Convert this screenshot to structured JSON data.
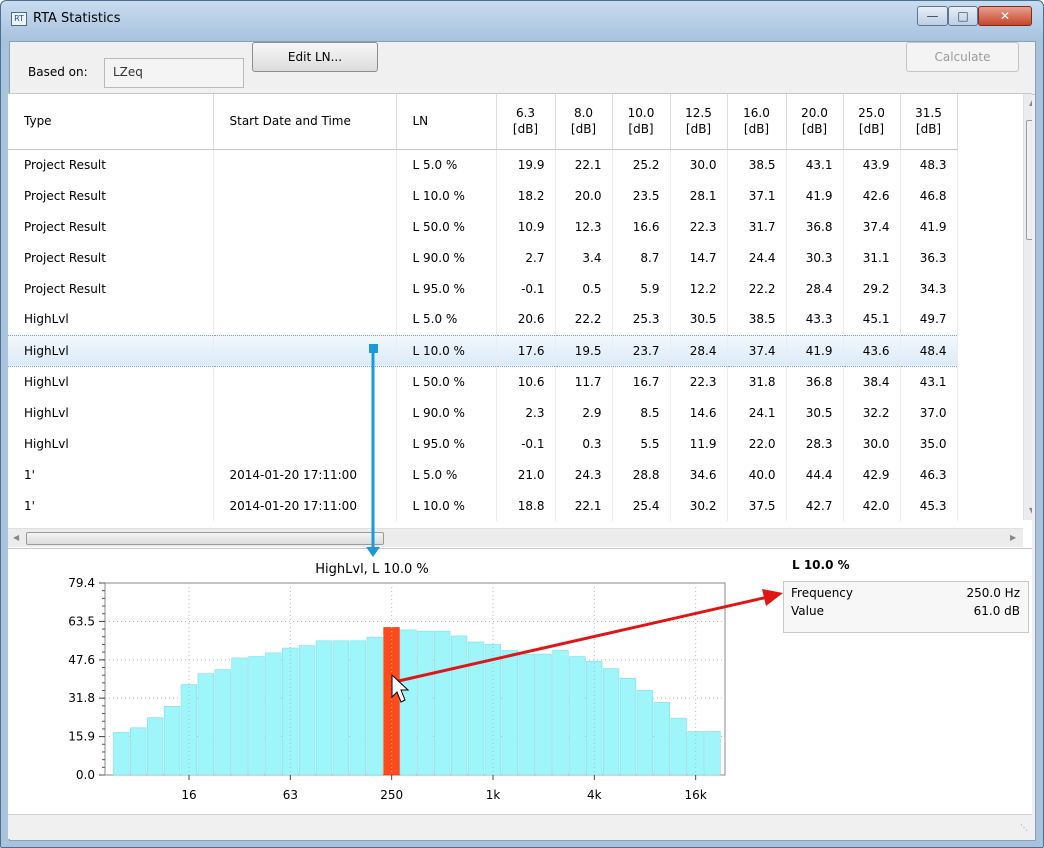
{
  "window": {
    "title": "RTA Statistics",
    "icon": "rta-app-icon",
    "controls": [
      "minimize",
      "maximize",
      "close"
    ]
  },
  "toolbar": {
    "based_on_label": "Based on:",
    "based_on_value": "LZeq",
    "edit_button": "Edit LN...",
    "calculate_button": "Calculate"
  },
  "table": {
    "columns": [
      "Type",
      "Start Date and Time",
      "LN"
    ],
    "freq_columns": [
      {
        "freq": "6.3",
        "unit": "[dB]"
      },
      {
        "freq": "8.0",
        "unit": "[dB]"
      },
      {
        "freq": "10.0",
        "unit": "[dB]"
      },
      {
        "freq": "12.5",
        "unit": "[dB]"
      },
      {
        "freq": "16.0",
        "unit": "[dB]"
      },
      {
        "freq": "20.0",
        "unit": "[dB]"
      },
      {
        "freq": "25.0",
        "unit": "[dB]"
      },
      {
        "freq": "31.5",
        "unit": "[dB]"
      }
    ],
    "rows": [
      {
        "type": "Project Result",
        "start": "",
        "ln": "L 5.0 %",
        "values": [
          "19.9",
          "22.1",
          "25.2",
          "30.0",
          "38.5",
          "43.1",
          "43.9",
          "48.3"
        ]
      },
      {
        "type": "Project Result",
        "start": "",
        "ln": "L 10.0 %",
        "values": [
          "18.2",
          "20.0",
          "23.5",
          "28.1",
          "37.1",
          "41.9",
          "42.6",
          "46.8"
        ]
      },
      {
        "type": "Project Result",
        "start": "",
        "ln": "L 50.0 %",
        "values": [
          "10.9",
          "12.3",
          "16.6",
          "22.3",
          "31.7",
          "36.8",
          "37.4",
          "41.9"
        ]
      },
      {
        "type": "Project Result",
        "start": "",
        "ln": "L 90.0 %",
        "values": [
          "2.7",
          "3.4",
          "8.7",
          "14.7",
          "24.4",
          "30.3",
          "31.1",
          "36.3"
        ]
      },
      {
        "type": "Project Result",
        "start": "",
        "ln": "L 95.0 %",
        "values": [
          "-0.1",
          "0.5",
          "5.9",
          "12.2",
          "22.2",
          "28.4",
          "29.2",
          "34.3"
        ]
      },
      {
        "type": "HighLvl",
        "start": "",
        "ln": "L 5.0 %",
        "values": [
          "20.6",
          "22.2",
          "25.3",
          "30.5",
          "38.5",
          "43.3",
          "45.1",
          "49.7"
        ]
      },
      {
        "type": "HighLvl",
        "start": "",
        "ln": "L 10.0 %",
        "values": [
          "17.6",
          "19.5",
          "23.7",
          "28.4",
          "37.4",
          "41.9",
          "43.6",
          "48.4"
        ],
        "selected": true
      },
      {
        "type": "HighLvl",
        "start": "",
        "ln": "L 50.0 %",
        "values": [
          "10.6",
          "11.7",
          "16.7",
          "22.3",
          "31.8",
          "36.8",
          "38.4",
          "43.1"
        ]
      },
      {
        "type": "HighLvl",
        "start": "",
        "ln": "L 90.0 %",
        "values": [
          "2.3",
          "2.9",
          "8.5",
          "14.6",
          "24.1",
          "30.5",
          "32.2",
          "37.0"
        ]
      },
      {
        "type": "HighLvl",
        "start": "",
        "ln": "L 95.0 %",
        "values": [
          "-0.1",
          "0.3",
          "5.5",
          "11.9",
          "22.0",
          "28.3",
          "30.0",
          "35.0"
        ]
      },
      {
        "type": "1'",
        "start": "2014-01-20 17:11:00",
        "ln": "L 5.0 %",
        "values": [
          "21.0",
          "24.3",
          "28.8",
          "34.6",
          "40.0",
          "44.4",
          "42.9",
          "46.3"
        ]
      },
      {
        "type": "1'",
        "start": "2014-01-20 17:11:00",
        "ln": "L 10.0 %",
        "values": [
          "18.8",
          "22.1",
          "25.4",
          "30.2",
          "37.5",
          "42.7",
          "42.0",
          "45.3"
        ]
      }
    ]
  },
  "chart_data": {
    "type": "bar",
    "title": "HighLvl, L 10.0 %",
    "ylim": [
      0,
      79.4
    ],
    "yticks": [
      "79.4",
      "63.5",
      "47.6",
      "31.8",
      "15.9",
      "0.0"
    ],
    "xticks": [
      "16",
      "63",
      "250",
      "1k",
      "4k",
      "16k"
    ],
    "bar_color": "#9ef5fa",
    "highlight_color": "#ff4a1a",
    "highlight_index": 16,
    "values": [
      17.6,
      19.5,
      23.7,
      28.4,
      37.4,
      41.9,
      43.6,
      48.4,
      49.0,
      50.5,
      52.5,
      53.5,
      55.5,
      55.5,
      55.5,
      57.0,
      61.0,
      60.0,
      59.5,
      59.5,
      57.5,
      55.0,
      54.0,
      51.5,
      50.0,
      50.0,
      51.5,
      49.0,
      47.0,
      44.0,
      40.0,
      35.0,
      30.0,
      23.5,
      18.0,
      18.0
    ]
  },
  "info_panel": {
    "title": "L 10.0 %",
    "rows": [
      {
        "label": "Frequency",
        "value": "250.0 Hz"
      },
      {
        "label": "Value",
        "value": "61.0 dB"
      }
    ]
  },
  "annotations": {
    "blue_connector_color": "#1a9ad9",
    "red_arrow_color": "#e01515"
  }
}
